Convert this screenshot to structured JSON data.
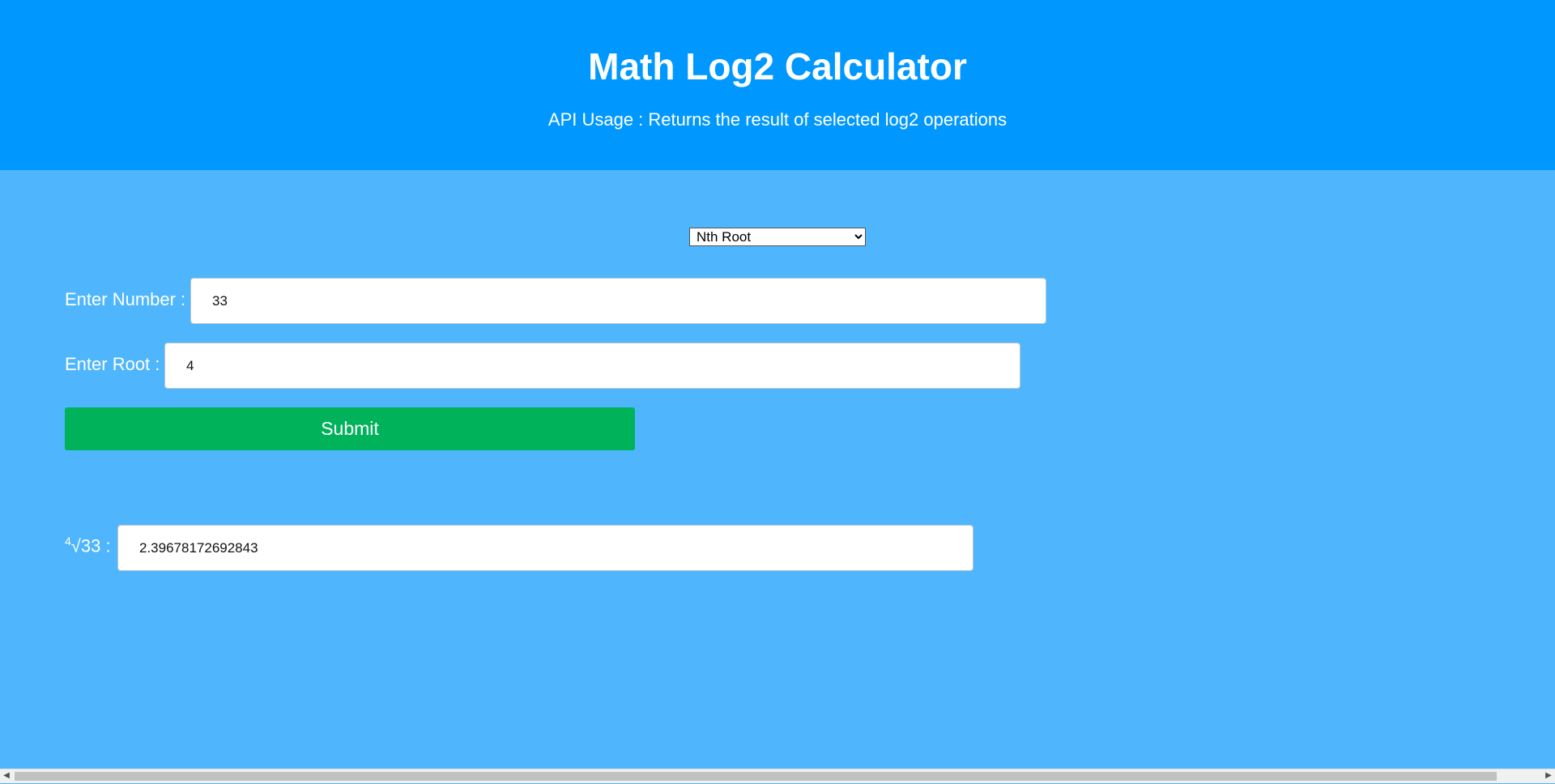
{
  "header": {
    "title": "Math Log2 Calculator",
    "subtitle": "API Usage : Returns the result of selected log2 operations"
  },
  "operation": {
    "selected": "Nth Root",
    "options": [
      "Nth Root"
    ]
  },
  "form": {
    "number_label": "Enter Number :",
    "number_value": "33",
    "root_label": "Enter Root :",
    "root_value": "4",
    "submit_label": "Submit"
  },
  "result": {
    "root_index": "4",
    "expression": "√33 :",
    "value": "2.39678172692843"
  },
  "colors": {
    "header_bg": "#0098fe",
    "body_bg": "#4fb6fd",
    "submit_bg": "#00b35a"
  },
  "scrollbar": {
    "left_arrow": "◀",
    "right_arrow": "▶"
  }
}
